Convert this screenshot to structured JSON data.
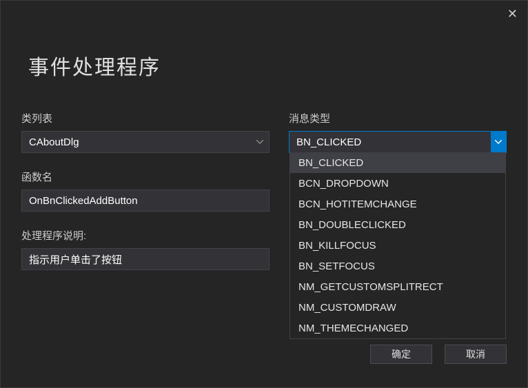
{
  "close_glyph": "✕",
  "title": "事件处理程序",
  "class_list": {
    "label": "类列表",
    "value": "CAboutDlg"
  },
  "message_type": {
    "label": "消息类型",
    "value": "BN_CLICKED",
    "options": [
      "BN_CLICKED",
      "BCN_DROPDOWN",
      "BCN_HOTITEMCHANGE",
      "BN_DOUBLECLICKED",
      "BN_KILLFOCUS",
      "BN_SETFOCUS",
      "NM_GETCUSTOMSPLITRECT",
      "NM_CUSTOMDRAW",
      "NM_THEMECHANGED"
    ]
  },
  "function_name": {
    "label": "函数名",
    "value": "OnBnClickedAddButton"
  },
  "handler_desc": {
    "label": "处理程序说明:",
    "value": "指示用户单击了按钮"
  },
  "buttons": {
    "ok": "确定",
    "cancel": "取消"
  }
}
